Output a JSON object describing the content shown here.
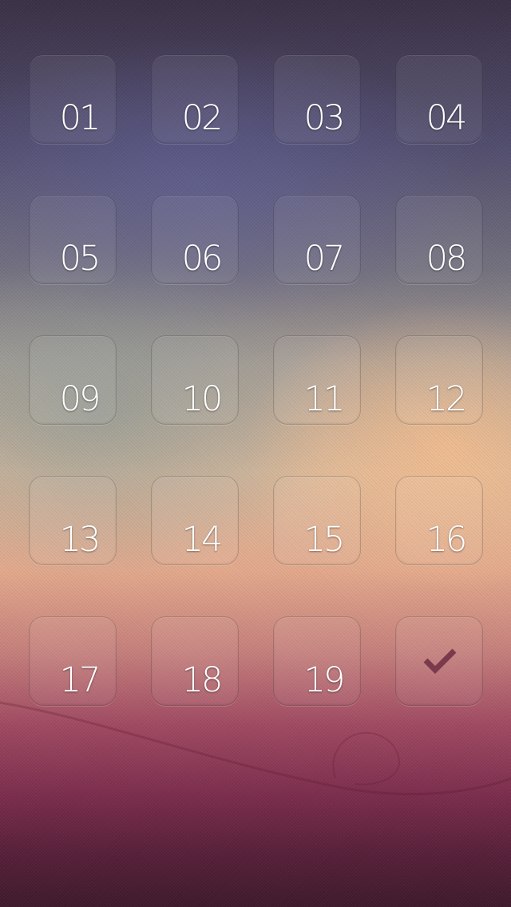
{
  "keypad": {
    "keys": [
      {
        "label": "01"
      },
      {
        "label": "02"
      },
      {
        "label": "03"
      },
      {
        "label": "04"
      },
      {
        "label": "05"
      },
      {
        "label": "06"
      },
      {
        "label": "07"
      },
      {
        "label": "08"
      },
      {
        "label": "09"
      },
      {
        "label": "10"
      },
      {
        "label": "11"
      },
      {
        "label": "12"
      },
      {
        "label": "13"
      },
      {
        "label": "14"
      },
      {
        "label": "15"
      },
      {
        "label": "16"
      },
      {
        "label": "17"
      },
      {
        "label": "18"
      },
      {
        "label": "19"
      }
    ],
    "confirm_icon": "checkmark-icon",
    "confirm_icon_color": "#7a3a4c"
  },
  "colors": {
    "label_text": "#ffffff",
    "wallpaper_top": "#3b3146",
    "wallpaper_middle": "#e3a98c",
    "wallpaper_bottom": "#3e1a2c"
  }
}
